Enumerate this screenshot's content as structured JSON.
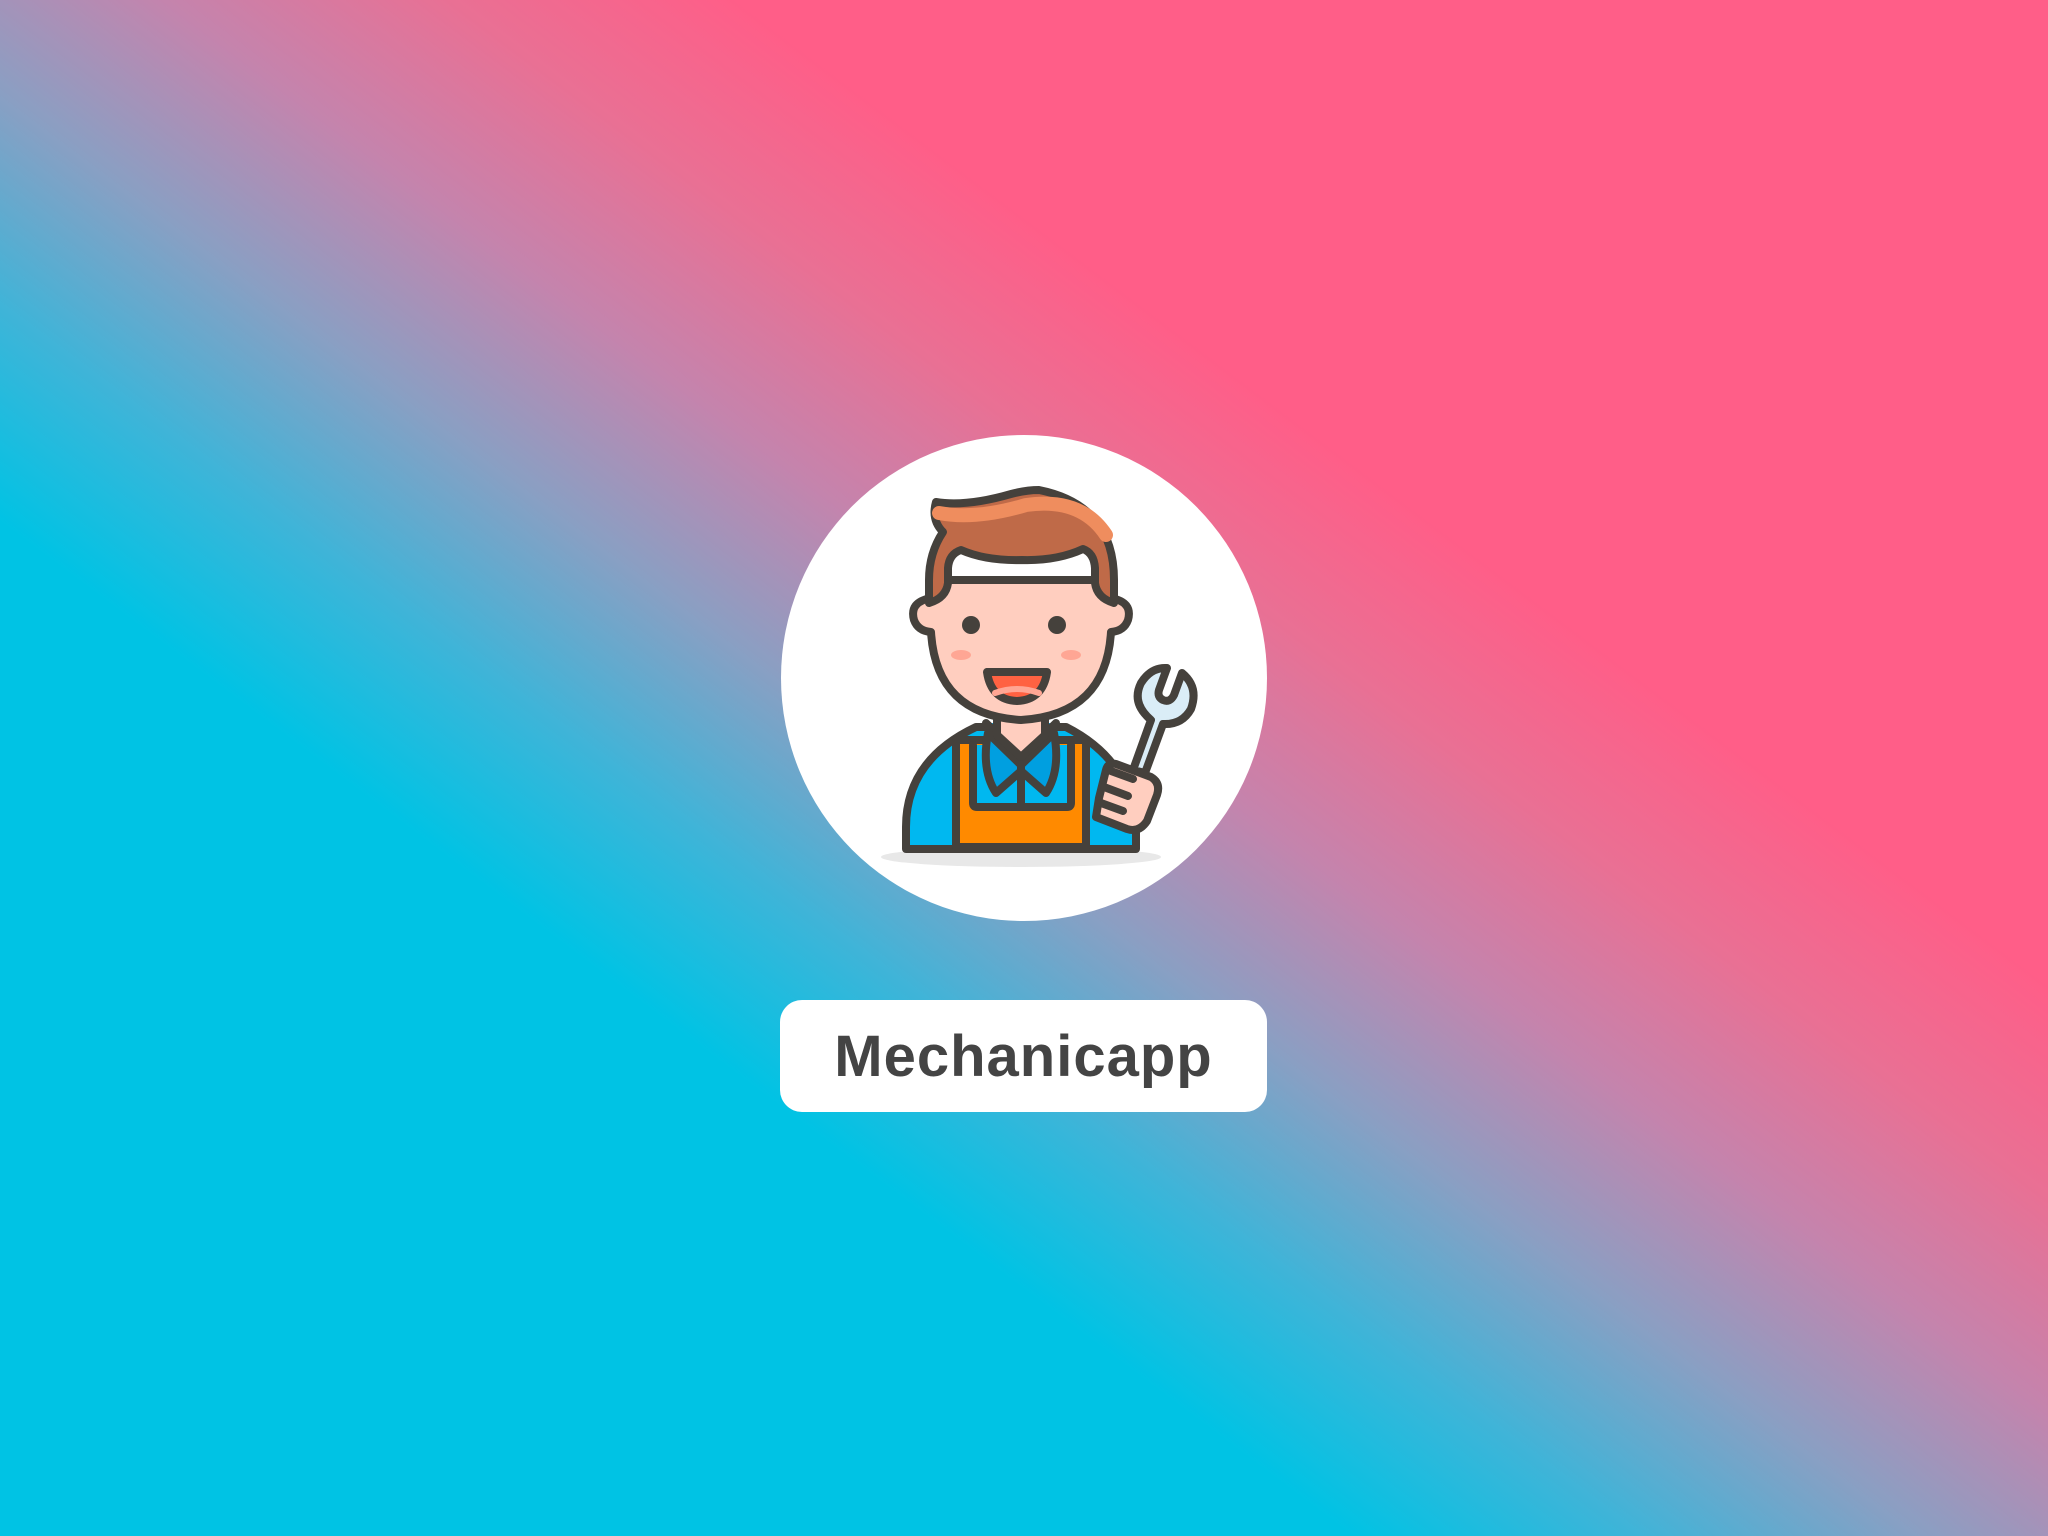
{
  "app": {
    "name": "Mechanicapp"
  },
  "logo": {
    "icon": "mechanic-avatar-icon",
    "tool_icon": "wrench-icon"
  },
  "colors": {
    "gradient_blue": "#00c3e4",
    "gradient_pink": "#ff5e88",
    "label_text": "#444444"
  }
}
